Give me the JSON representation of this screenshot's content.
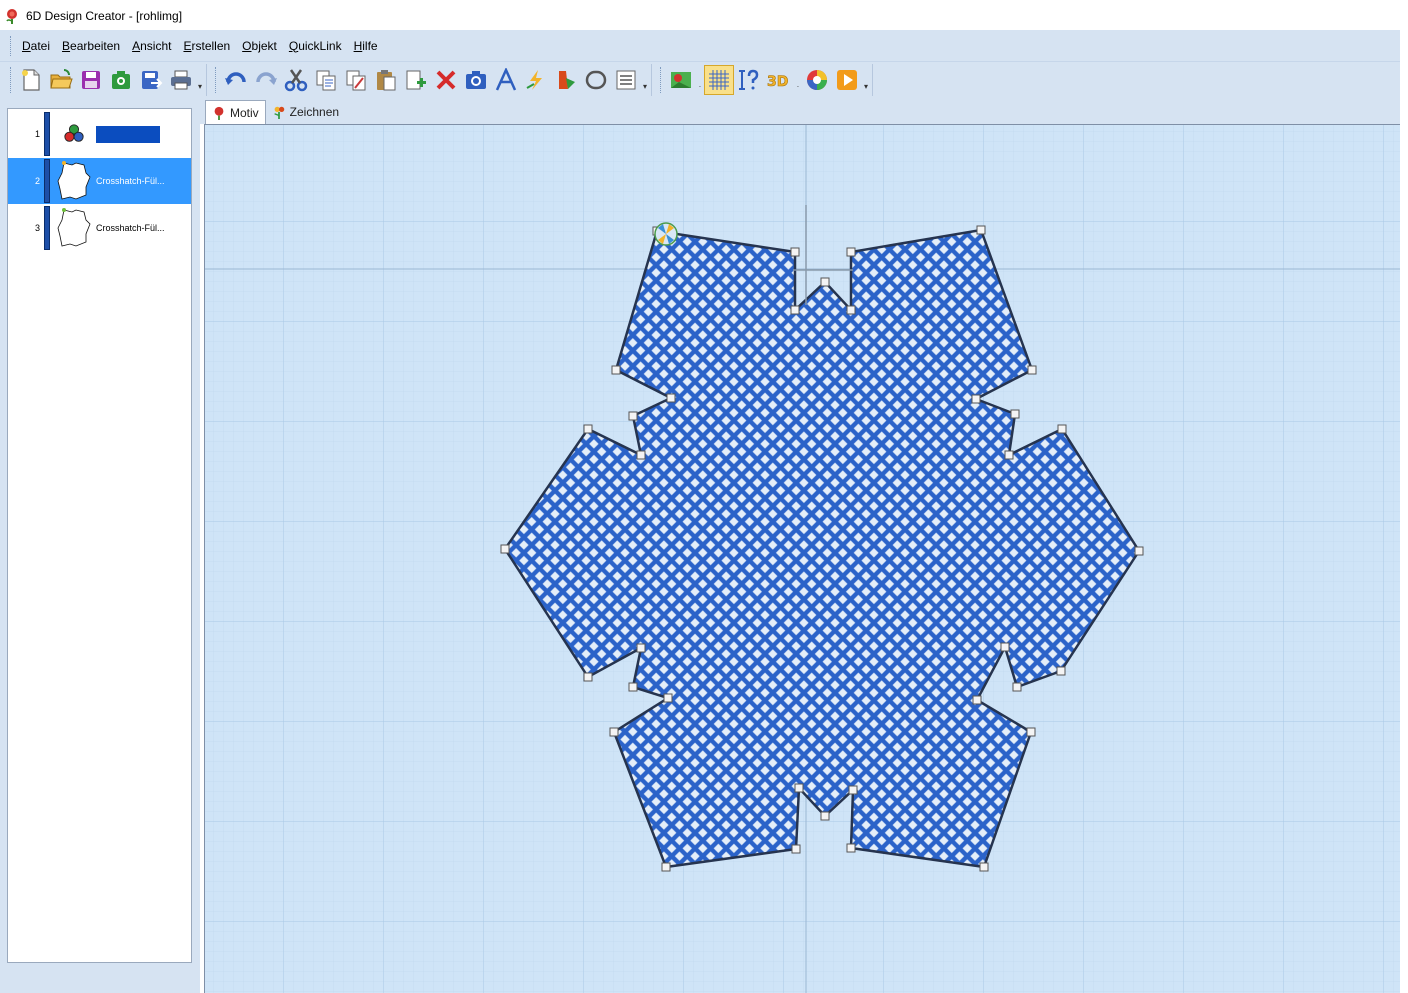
{
  "window": {
    "title": "6D Design Creator - [rohlimg]",
    "app_icon": "rose-icon"
  },
  "menu": [
    {
      "label": "Datei",
      "key": "D",
      "rest": "atei"
    },
    {
      "label": "Bearbeiten",
      "key": "B",
      "rest": "earbeiten"
    },
    {
      "label": "Ansicht",
      "key": "A",
      "rest": "nsicht"
    },
    {
      "label": "Erstellen",
      "key": "E",
      "rest": "rstellen"
    },
    {
      "label": "Objekt",
      "key": "O",
      "rest": "bjekt"
    },
    {
      "label": "QuickLink",
      "key": "Q",
      "rest": "uickLink"
    },
    {
      "label": "Hilfe",
      "key": "H",
      "rest": "ilfe"
    }
  ],
  "toolbar": {
    "file_group": [
      "new-icon",
      "open-icon",
      "save-icon",
      "save-embroidery-icon",
      "export-icon",
      "print-icon"
    ],
    "edit_group": [
      "undo-icon",
      "redo-icon",
      "cut-icon",
      "copy-icon",
      "copy-special-icon",
      "paste-icon",
      "paste-special-icon",
      "delete-icon",
      "snapshot-icon",
      "lettering-icon",
      "quickstitch-icon",
      "fill-icon",
      "shape-icon",
      "properties-icon"
    ],
    "view_group": [
      "background-icon",
      "grid-icon",
      "measure-icon",
      "3d-icon",
      "color-wheel-icon",
      "play-icon"
    ],
    "view_3d_label": "3D"
  },
  "layers": [
    {
      "number": "1",
      "type": "color",
      "label": "",
      "color": "#0b4dbf",
      "selected": false
    },
    {
      "number": "2",
      "type": "crosshatch",
      "label": "Crosshatch-Fül...",
      "selected": true
    },
    {
      "number": "3",
      "type": "crosshatch",
      "label": "Crosshatch-Fül...",
      "selected": false
    }
  ],
  "tabs": [
    {
      "label": "Motiv",
      "icon": "rose-icon",
      "active": true
    },
    {
      "label": "Zeichnen",
      "icon": "draw-flower-icon",
      "active": false
    }
  ],
  "design": {
    "fill_type": "crosshatch",
    "fill_color": "#2b63c9",
    "line_color": "#17397e",
    "outline_color": "#26344f",
    "canvas_color": "#cfe4f7",
    "grid_color": "#b2d0ea"
  }
}
